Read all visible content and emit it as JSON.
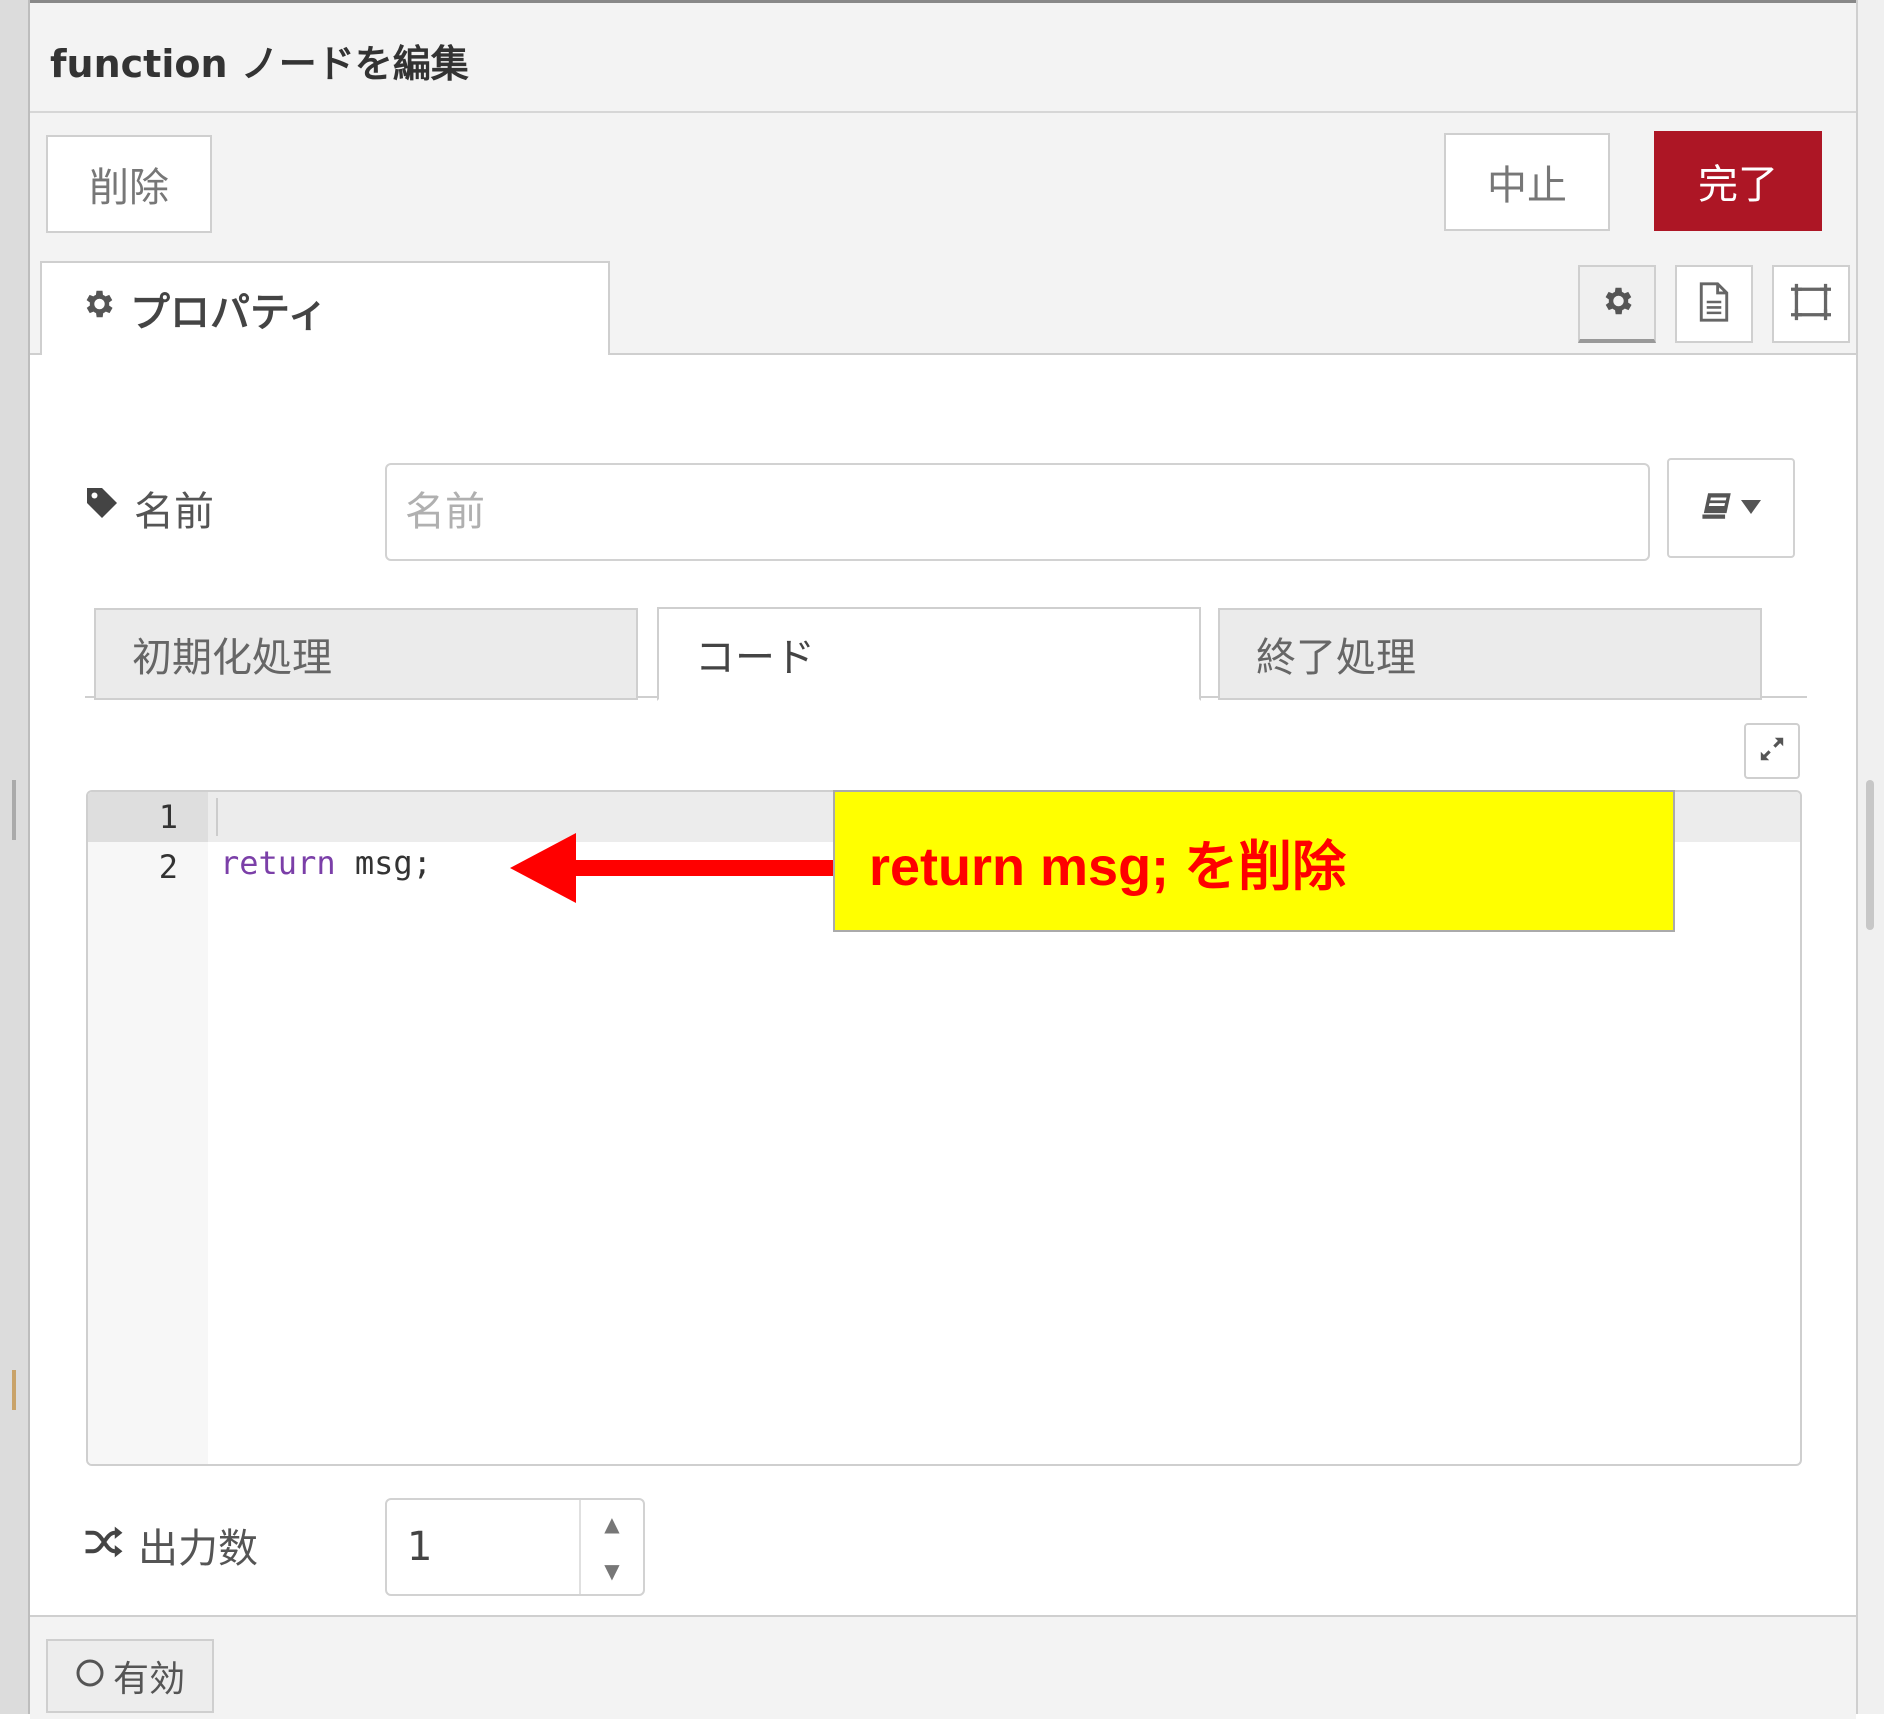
{
  "header": {
    "title": "function ノードを編集"
  },
  "toolbar": {
    "delete_label": "削除",
    "cancel_label": "中止",
    "done_label": "完了"
  },
  "tabs": {
    "properties_label": "プロパティ"
  },
  "icons": {
    "properties": "gear-icon",
    "description": "document-icon",
    "appearance": "frame-icon",
    "name": "tag-icon",
    "outputs": "shuffle-icon",
    "expand": "expand-icon"
  },
  "form": {
    "name_label": "名前",
    "name_placeholder": "名前",
    "name_value": "",
    "subtabs": [
      {
        "label": "初期化処理"
      },
      {
        "label": "コード"
      },
      {
        "label": "終了処理"
      }
    ],
    "active_subtab": "コード",
    "outputs_label": "出力数",
    "outputs_value": "1"
  },
  "editor": {
    "lines": [
      {
        "number": "1",
        "text": ""
      },
      {
        "number": "2",
        "keyword": "return",
        "rest": " msg;"
      }
    ]
  },
  "annotation": {
    "text": "return msg; を削除",
    "background": "#ffff00",
    "color": "#ff0000"
  },
  "footer": {
    "enable_label": "有効"
  },
  "colors": {
    "accent": "#ad1625",
    "keyword": "#7b3fa8"
  }
}
